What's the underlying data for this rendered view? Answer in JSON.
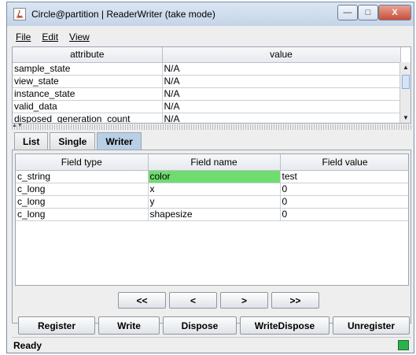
{
  "window": {
    "title": "Circle@partition | ReaderWriter (take mode)",
    "controls": {
      "minimize": "—",
      "maximize": "□",
      "close": "X"
    }
  },
  "menu": {
    "file": "File",
    "edit": "Edit",
    "view": "View"
  },
  "attributes": {
    "headers": [
      "attribute",
      "value"
    ],
    "rows": [
      [
        "sample_state",
        "N/A"
      ],
      [
        "view_state",
        "N/A"
      ],
      [
        "instance_state",
        "N/A"
      ],
      [
        "valid_data",
        "N/A"
      ],
      [
        "disposed_generation_count",
        "N/A"
      ]
    ]
  },
  "tabs": [
    "List",
    "Single",
    "Writer"
  ],
  "active_tab": "Writer",
  "fields": {
    "headers": [
      "Field type",
      "Field name",
      "Field value"
    ],
    "rows": [
      [
        "c_string",
        "color",
        "test"
      ],
      [
        "c_long",
        "x",
        "0"
      ],
      [
        "c_long",
        "y",
        "0"
      ],
      [
        "c_long",
        "shapesize",
        "0"
      ]
    ],
    "highlight_color": "#6fdc6f"
  },
  "navigation": {
    "first": "<<",
    "prev": "<",
    "next": ">",
    "last": ">>"
  },
  "actions": {
    "register": "Register",
    "write": "Write",
    "dispose": "Dispose",
    "write_dispose": "WriteDispose",
    "unregister": "Unregister"
  },
  "status": {
    "text": "Ready",
    "indicator_color": "#2bb24c"
  }
}
